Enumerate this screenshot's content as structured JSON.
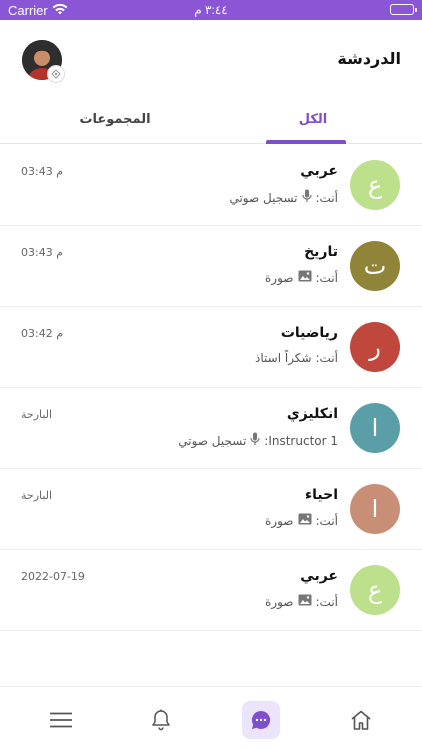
{
  "status_bar": {
    "carrier": "Carrier",
    "time": "٣:٤٤ م"
  },
  "header": {
    "title": "الدردشة"
  },
  "tabs": [
    {
      "label": "الكل",
      "active": true
    },
    {
      "label": "المجموعات",
      "active": false
    }
  ],
  "chats": [
    {
      "name": "عربي",
      "avatar_letter": "ع",
      "avatar_color": "#bde08c",
      "sender": "أنت:",
      "preview": "تسجيل صوتي",
      "preview_icon": "microphone-icon",
      "time": "03:43 م"
    },
    {
      "name": "تاريخ",
      "avatar_letter": "ت",
      "avatar_color": "#8f8438",
      "sender": "أنت:",
      "preview": "صورة",
      "preview_icon": "image-icon",
      "time": "03:43 م"
    },
    {
      "name": "رياضيات",
      "avatar_letter": "ر",
      "avatar_color": "#c0473c",
      "sender": "أنت:",
      "preview": "شكراً استاذ",
      "preview_icon": "",
      "time": "03:42 م"
    },
    {
      "name": "انكليزي",
      "avatar_letter": "ا",
      "avatar_color": "#5a9fa8",
      "sender": "Instructor 1:",
      "preview": "تسجيل صوتي",
      "preview_icon": "microphone-icon",
      "time": "البارحة"
    },
    {
      "name": "احياء",
      "avatar_letter": "ا",
      "avatar_color": "#c98f76",
      "sender": "أنت:",
      "preview": "صورة",
      "preview_icon": "image-icon",
      "time": "البارحة"
    },
    {
      "name": "عربي",
      "avatar_letter": "ع",
      "avatar_color": "#bde08c",
      "sender": "أنت:",
      "preview": "صورة",
      "preview_icon": "image-icon",
      "time": "2022-07-19"
    }
  ],
  "bottom_nav": [
    {
      "icon": "menu-icon",
      "active": false
    },
    {
      "icon": "bell-icon",
      "active": false
    },
    {
      "icon": "chat-icon",
      "active": true
    },
    {
      "icon": "home-icon",
      "active": false
    }
  ],
  "colors": {
    "accent": "#7b4fd0",
    "status_bar": "#8a56d6",
    "active_nav_bg": "#ece4fb"
  }
}
